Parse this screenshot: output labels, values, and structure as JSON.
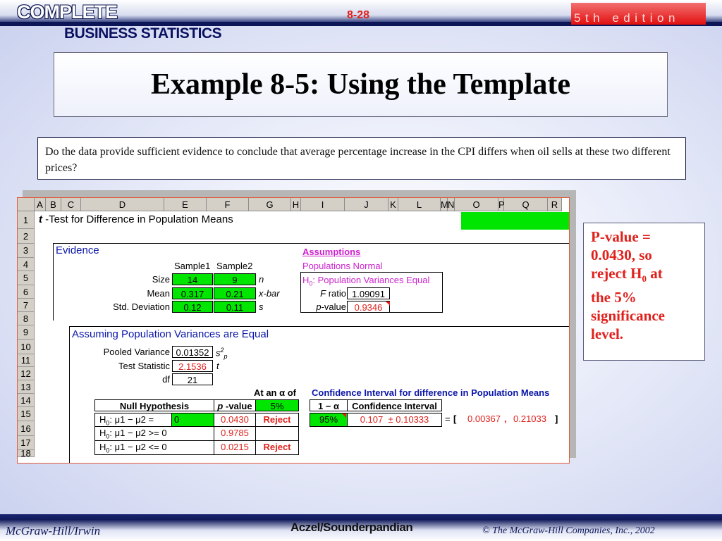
{
  "header": {
    "brand_line1": "COMPLETE",
    "brand_line2": "BUSINESS STATISTICS",
    "slide_number": "8-28",
    "edition": "5th edition"
  },
  "slide": {
    "title": "Example 8-5: Using the Template",
    "question": "Do the data provide sufficient evidence to conclude that average percentage increase in the CPI differs when oil sells at these two different prices?"
  },
  "spreadsheet": {
    "columns": [
      "A",
      "B",
      "C",
      "D",
      "E",
      "F",
      "G",
      "H",
      "I",
      "J",
      "K",
      "L",
      "M",
      "N",
      "O",
      "P",
      "Q",
      "R"
    ],
    "rows": [
      "1",
      "2",
      "3",
      "4",
      "5",
      "6",
      "7",
      "8",
      "9",
      "10",
      "11",
      "12",
      "13",
      "14",
      "15",
      "16",
      "17",
      "18"
    ],
    "title_t": "t",
    "title_rest": " -Test for Difference in Population Means",
    "evidence": {
      "heading": "Evidence",
      "sample1": "Sample1",
      "sample2": "Sample2",
      "size_label": "Size",
      "size1": "14",
      "size2": "9",
      "size_sym": "n",
      "mean_label": "Mean",
      "mean1": "0.317",
      "mean2": "0.21",
      "mean_sym": "x-bar",
      "sd_label": "Std. Deviation",
      "sd1": "0.12",
      "sd2": "0.11",
      "sd_sym": "s"
    },
    "assumptions": {
      "heading": "Assumptions",
      "normal": "Populations Normal",
      "h0_prefix": "H",
      "h0_sub": "0",
      "h0_text": ": Population Variances Equal",
      "f_label_sym": "F",
      "f_label": " ratio",
      "f_value": "1.09091",
      "p_label_sym": "p",
      "p_label": "-value",
      "p_value": "0.9346"
    },
    "equal_var": {
      "heading": "Assuming Population Variances are Equal",
      "pooled_label": "Pooled Variance",
      "pooled_value": "0.01352",
      "pooled_sym": "s",
      "pooled_sup": "2",
      "pooled_sub": "p",
      "stat_label": "Test Statistic",
      "stat_value": "2.1536",
      "stat_sym": "t",
      "df_label": "df",
      "df_value": "21",
      "alpha_label": "At an α of",
      "ci_heading": "Confidence Interval for difference in Population Means"
    },
    "tests": {
      "col_null": "Null Hypothesis",
      "col_p_sym": "p",
      "col_p": " -value",
      "alpha": "5%",
      "rows": [
        {
          "h": "H",
          "sub": "0",
          "rel": ": μ1 − μ2 =",
          "val": "0",
          "p": "0.0430",
          "decision": "Reject"
        },
        {
          "h": "H",
          "sub": "0",
          "rel": ": μ1 − μ2 >=",
          "val": "0",
          "p": "0.9785",
          "decision": ""
        },
        {
          "h": "H",
          "sub": "0",
          "rel": ": μ1 − μ2 <=",
          "val": "0",
          "p": "0.0215",
          "decision": "Reject"
        }
      ]
    },
    "ci": {
      "col_conf": "1 − α",
      "col_ci": "Confidence Interval",
      "conf": "95%",
      "center": "0.107",
      "pm": "±",
      "half": "0.10333",
      "eq": "=",
      "lb": "[",
      "low": "0.00367",
      "comma": ",",
      "high": "0.21033",
      "rb": "]"
    }
  },
  "note": {
    "line1": "P-value =",
    "line2": "0.0430, so",
    "line3_pre": "reject H",
    "line3_sub": "0",
    "line3_post": " at",
    "line4": "the 5%",
    "line5": "significance",
    "line6": "level."
  },
  "footer": {
    "left": "McGraw-Hill/Irwin",
    "center": "Aczel/Sounderpandian",
    "right": "© The McGraw-Hill Companies, Inc., 2002"
  },
  "colors": {
    "accent_red": "#e0211c",
    "navy": "#0c1657",
    "cell_green": "#00e600",
    "heading_blue": "#0b16a8"
  }
}
